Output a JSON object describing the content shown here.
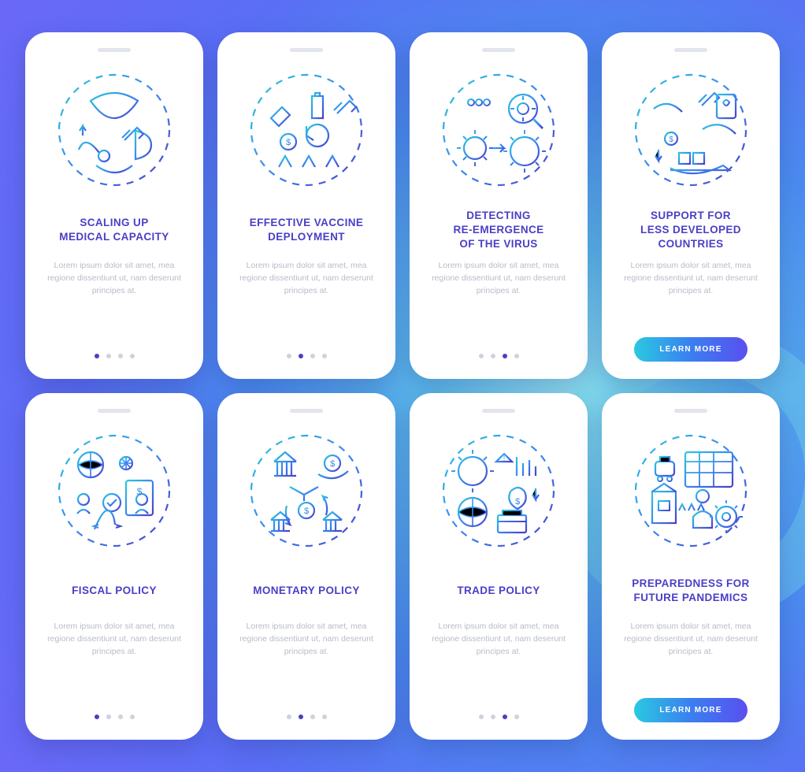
{
  "lorem": "Lorem ipsum dolor sit amet, mea regione dissentiunt ut, nam deserunt principes at.",
  "cta_label": "LEARN MORE",
  "rows": [
    {
      "cards": [
        {
          "title": "SCALING UP\nMEDICAL CAPACITY",
          "active": 0,
          "total": 4,
          "cta": false,
          "icon": "medical"
        },
        {
          "title": "EFFECTIVE VACCINE\nDEPLOYMENT",
          "active": 1,
          "total": 4,
          "cta": false,
          "icon": "vaccine"
        },
        {
          "title": "DETECTING\nRE-EMERGENCE\nOF THE VIRUS",
          "active": 2,
          "total": 4,
          "cta": false,
          "icon": "detect"
        },
        {
          "title": "SUPPORT FOR\nLESS DEVELOPED\nCOUNTRIES",
          "active": 3,
          "total": 4,
          "cta": true,
          "icon": "support"
        }
      ]
    },
    {
      "cards": [
        {
          "title": "FISCAL POLICY",
          "active": 0,
          "total": 4,
          "cta": false,
          "icon": "fiscal"
        },
        {
          "title": "MONETARY POLICY",
          "active": 1,
          "total": 4,
          "cta": false,
          "icon": "monetary"
        },
        {
          "title": "TRADE POLICY",
          "active": 2,
          "total": 4,
          "cta": false,
          "icon": "trade"
        },
        {
          "title": "PREPAREDNESS FOR\nFUTURE PANDEMICS",
          "active": 3,
          "total": 4,
          "cta": true,
          "icon": "prepared"
        }
      ]
    }
  ]
}
